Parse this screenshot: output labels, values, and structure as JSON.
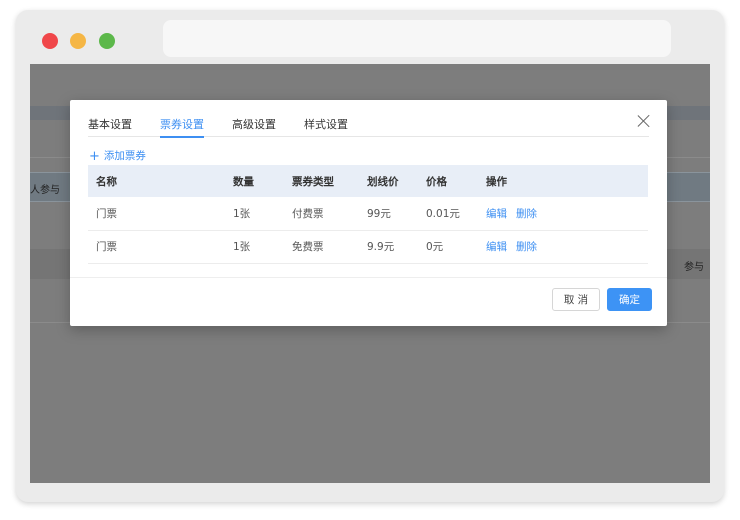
{
  "background": {
    "left_label": "人参与",
    "right_label": "参与"
  },
  "dialog": {
    "tabs": [
      {
        "label": "基本设置",
        "active": false
      },
      {
        "label": "票券设置",
        "active": true
      },
      {
        "label": "高级设置",
        "active": false
      },
      {
        "label": "样式设置",
        "active": false
      }
    ],
    "add_ticket_label": "添加票券",
    "table": {
      "headers": [
        "名称",
        "数量",
        "票券类型",
        "划线价",
        "价格",
        "操作"
      ],
      "rows": [
        {
          "name": "门票",
          "quantity": "1张",
          "type": "付费票",
          "list_price": "99元",
          "price": "0.01元"
        },
        {
          "name": "门票",
          "quantity": "1张",
          "type": "免费票",
          "list_price": "9.9元",
          "price": "0元"
        }
      ],
      "actions": {
        "edit": "编辑",
        "delete": "删除"
      }
    },
    "cancel_label": "取 消",
    "confirm_label": "确定"
  },
  "colors": {
    "accent": "#3d8ff2",
    "overlay": "#7d7d7d",
    "header_bg": "#e8eef7"
  }
}
